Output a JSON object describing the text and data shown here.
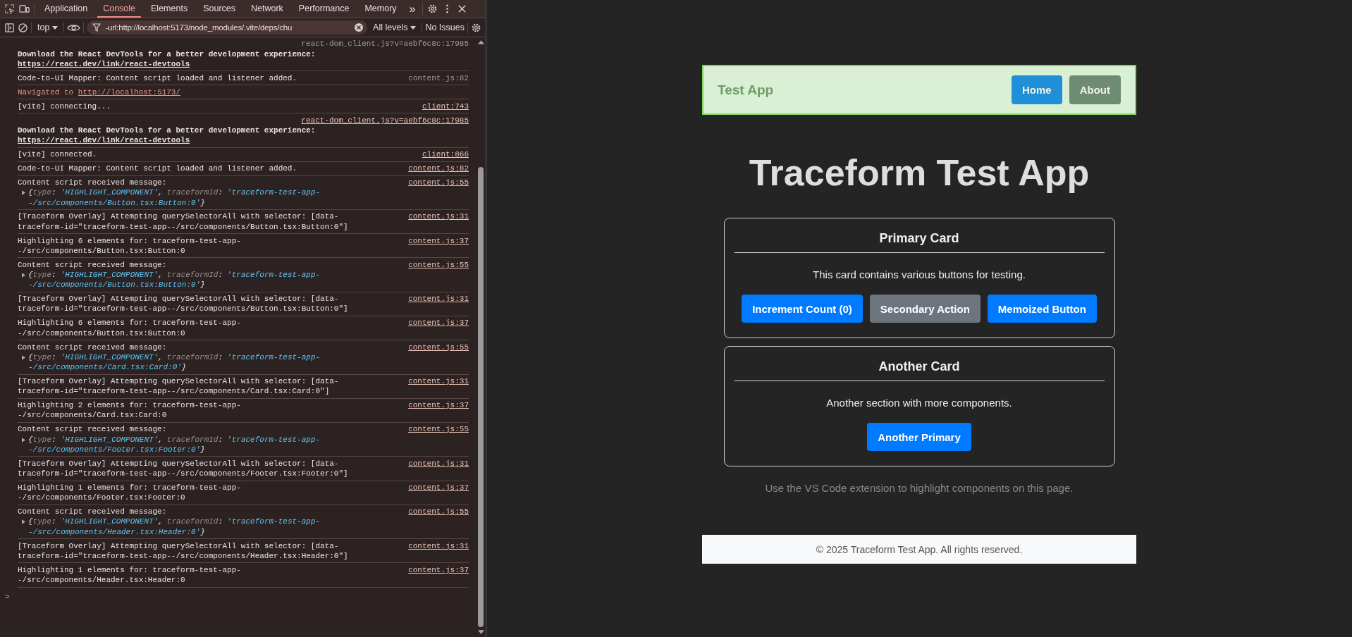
{
  "devtools": {
    "tabs": [
      {
        "label": "Application",
        "selected": false
      },
      {
        "label": "Console",
        "selected": true
      },
      {
        "label": "Elements",
        "selected": false
      },
      {
        "label": "Sources",
        "selected": false
      },
      {
        "label": "Network",
        "selected": false
      },
      {
        "label": "Performance",
        "selected": false
      },
      {
        "label": "Memory",
        "selected": false
      }
    ],
    "more_tabs": "»",
    "context": "top",
    "filter": {
      "value": "-url:http://localhost:5173/node_modules/.vite/deps/chu"
    },
    "levels": "All levels",
    "issues": "No Issues",
    "messages": [
      {
        "kind": "devtools",
        "source": "react-dom_client.js?v=aebf6c8c:17985",
        "source_underlined": false,
        "text": "Download the React DevTools for a better development experience:",
        "link": "https://react.dev/link/react-devtools"
      },
      {
        "kind": "log",
        "source": "content.js:82",
        "source_underlined": false,
        "text": "Code-to-UI Mapper: Content script loaded and listener added."
      },
      {
        "kind": "navigation",
        "text": "Navigated to",
        "link": "http://localhost:5173/"
      },
      {
        "kind": "log",
        "source": "client:743",
        "source_underlined": true,
        "text": "[vite] connecting..."
      },
      {
        "kind": "devtools",
        "source": "react-dom_client.js?v=aebf6c8c:17985",
        "source_underlined": true,
        "text": "Download the React DevTools for a better development experience:",
        "link": "https://react.dev/link/react-devtools"
      },
      {
        "kind": "log",
        "source": "client:866",
        "source_underlined": true,
        "text": "[vite] connected."
      },
      {
        "kind": "log",
        "source": "content.js:82",
        "source_underlined": true,
        "text": "Code-to-UI Mapper: Content script loaded and listener added."
      },
      {
        "kind": "object",
        "source": "content.js:55",
        "source_underlined": true,
        "text": "Content script received message:",
        "object": [
          {
            "kind": "punct",
            "text": "{"
          },
          {
            "kind": "key",
            "text": "type"
          },
          {
            "kind": "punct",
            "text": ":"
          },
          {
            "kind": "string",
            "text": "'HIGHLIGHT_COMPONENT'"
          },
          {
            "kind": "punct",
            "text": ","
          },
          {
            "kind": "key",
            "text": "traceformId"
          },
          {
            "kind": "punct",
            "text": ":"
          },
          {
            "kind": "string",
            "text": "'traceform-test-app--/src/components/Button.tsx:Button:0'"
          },
          {
            "kind": "punct",
            "text": "}"
          }
        ]
      },
      {
        "kind": "log",
        "source": "content.js:31",
        "source_underlined": true,
        "text": "[Traceform Overlay] Attempting querySelectorAll with selector: [data-traceform-id=\"traceform-test-app--/src/components/Button.tsx:Button:0\"]"
      },
      {
        "kind": "log",
        "source": "content.js:37",
        "source_underlined": true,
        "text": "Highlighting 6 elements for: traceform-test-app--/src/components/Button.tsx:Button:0"
      },
      {
        "kind": "object",
        "source": "content.js:55",
        "source_underlined": true,
        "text": "Content script received message:",
        "object": [
          {
            "kind": "punct",
            "text": "{"
          },
          {
            "kind": "key",
            "text": "type"
          },
          {
            "kind": "punct",
            "text": ":"
          },
          {
            "kind": "string",
            "text": "'HIGHLIGHT_COMPONENT'"
          },
          {
            "kind": "punct",
            "text": ","
          },
          {
            "kind": "key",
            "text": "traceformId"
          },
          {
            "kind": "punct",
            "text": ":"
          },
          {
            "kind": "string",
            "text": "'traceform-test-app--/src/components/Button.tsx:Button:0'"
          },
          {
            "kind": "punct",
            "text": "}"
          }
        ]
      },
      {
        "kind": "log",
        "source": "content.js:31",
        "source_underlined": true,
        "text": "[Traceform Overlay] Attempting querySelectorAll with selector: [data-traceform-id=\"traceform-test-app--/src/components/Button.tsx:Button:0\"]"
      },
      {
        "kind": "log",
        "source": "content.js:37",
        "source_underlined": true,
        "text": "Highlighting 6 elements for: traceform-test-app--/src/components/Button.tsx:Button:0"
      },
      {
        "kind": "object",
        "source": "content.js:55",
        "source_underlined": true,
        "text": "Content script received message:",
        "object": [
          {
            "kind": "punct",
            "text": "{"
          },
          {
            "kind": "key",
            "text": "type"
          },
          {
            "kind": "punct",
            "text": ":"
          },
          {
            "kind": "string",
            "text": "'HIGHLIGHT_COMPONENT'"
          },
          {
            "kind": "punct",
            "text": ","
          },
          {
            "kind": "key",
            "text": "traceformId"
          },
          {
            "kind": "punct",
            "text": ":"
          },
          {
            "kind": "string",
            "text": "'traceform-test-app--/src/components/Card.tsx:Card:0'"
          },
          {
            "kind": "punct",
            "text": "}"
          }
        ]
      },
      {
        "kind": "log",
        "source": "content.js:31",
        "source_underlined": true,
        "text": "[Traceform Overlay] Attempting querySelectorAll with selector: [data-traceform-id=\"traceform-test-app--/src/components/Card.tsx:Card:0\"]"
      },
      {
        "kind": "log",
        "source": "content.js:37",
        "source_underlined": true,
        "text": "Highlighting 2 elements for: traceform-test-app--/src/components/Card.tsx:Card:0"
      },
      {
        "kind": "object",
        "source": "content.js:55",
        "source_underlined": true,
        "text": "Content script received message:",
        "object": [
          {
            "kind": "punct",
            "text": "{"
          },
          {
            "kind": "key",
            "text": "type"
          },
          {
            "kind": "punct",
            "text": ":"
          },
          {
            "kind": "string",
            "text": "'HIGHLIGHT_COMPONENT'"
          },
          {
            "kind": "punct",
            "text": ","
          },
          {
            "kind": "key",
            "text": "traceformId"
          },
          {
            "kind": "punct",
            "text": ":"
          },
          {
            "kind": "string",
            "text": "'traceform-test-app--/src/components/Footer.tsx:Footer:0'"
          },
          {
            "kind": "punct",
            "text": "}"
          }
        ]
      },
      {
        "kind": "log",
        "source": "content.js:31",
        "source_underlined": true,
        "text": "[Traceform Overlay] Attempting querySelectorAll with selector: [data-traceform-id=\"traceform-test-app--/src/components/Footer.tsx:Footer:0\"]"
      },
      {
        "kind": "log",
        "source": "content.js:37",
        "source_underlined": true,
        "text": "Highlighting 1 elements for: traceform-test-app--/src/components/Footer.tsx:Footer:0"
      },
      {
        "kind": "object",
        "source": "content.js:55",
        "source_underlined": true,
        "text": "Content script received message:",
        "object": [
          {
            "kind": "punct",
            "text": "{"
          },
          {
            "kind": "key",
            "text": "type"
          },
          {
            "kind": "punct",
            "text": ":"
          },
          {
            "kind": "string",
            "text": "'HIGHLIGHT_COMPONENT'"
          },
          {
            "kind": "punct",
            "text": ","
          },
          {
            "kind": "key",
            "text": "traceformId"
          },
          {
            "kind": "punct",
            "text": ":"
          },
          {
            "kind": "string",
            "text": "'traceform-test-app--/src/components/Header.tsx:Header:0'"
          },
          {
            "kind": "punct",
            "text": "}"
          }
        ]
      },
      {
        "kind": "log",
        "source": "content.js:31",
        "source_underlined": true,
        "text": "[Traceform Overlay] Attempting querySelectorAll with selector: [data-traceform-id=\"traceform-test-app--/src/components/Header.tsx:Header:0\"]"
      },
      {
        "kind": "log",
        "source": "content.js:37",
        "source_underlined": true,
        "text": "Highlighting 1 elements for: traceform-test-app--/src/components/Header.tsx:Header:0"
      }
    ],
    "prompt": ">"
  },
  "app": {
    "header": {
      "title": "Test App",
      "highlighted": true,
      "nav": [
        {
          "label": "Home",
          "kind": "primary"
        },
        {
          "label": "About",
          "kind": "secondary"
        }
      ]
    },
    "title": "Traceform Test App",
    "cards": [
      {
        "title": "Primary Card",
        "text": "This card contains various buttons for testing.",
        "buttons": [
          {
            "label": "Increment Count (0)",
            "kind": "primary"
          },
          {
            "label": "Secondary Action",
            "kind": "secondary"
          },
          {
            "label": "Memoized Button",
            "kind": "primary"
          }
        ]
      },
      {
        "title": "Another Card",
        "text": "Another section with more components.",
        "buttons": [
          {
            "label": "Another Primary",
            "kind": "primary"
          }
        ]
      }
    ],
    "note": "Use the VS Code extension to highlight components on this page.",
    "footer": "© 2025 Traceform Test App. All rights reserved."
  }
}
